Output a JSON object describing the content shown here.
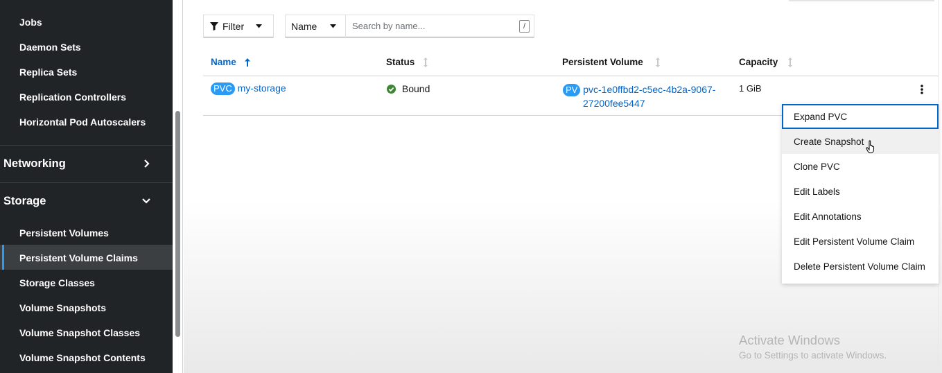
{
  "sidebar": {
    "items_top": [
      {
        "label": "Jobs"
      },
      {
        "label": "Daemon Sets"
      },
      {
        "label": "Replica Sets"
      },
      {
        "label": "Replication Controllers"
      },
      {
        "label": "Horizontal Pod Autoscalers"
      }
    ],
    "networking": {
      "label": "Networking",
      "icon": "chevron-right-icon"
    },
    "storage": {
      "label": "Storage",
      "icon": "chevron-down-icon"
    },
    "storage_items": [
      {
        "label": "Persistent Volumes"
      },
      {
        "label": "Persistent Volume Claims",
        "active": true
      },
      {
        "label": "Storage Classes"
      },
      {
        "label": "Volume Snapshots"
      },
      {
        "label": "Volume Snapshot Classes"
      },
      {
        "label": "Volume Snapshot Contents"
      }
    ]
  },
  "toolbar": {
    "filter_label": "Filter",
    "name_select": "Name",
    "search_placeholder": "Search by name...",
    "search_shortcut": "/"
  },
  "table": {
    "columns": [
      "Name",
      "Status",
      "Persistent Volume",
      "Capacity"
    ],
    "rows": [
      {
        "name_badge": "PVC",
        "name": "my-storage",
        "status": "Bound",
        "pv_badge": "PV",
        "pv_line1": "pvc-1e0ffbd2-c5ec-4b2a-9067-",
        "pv_line2": "27200fee5447",
        "capacity": "1 GiB"
      }
    ]
  },
  "menu": {
    "items": [
      "Expand PVC",
      "Create Snapshot",
      "Clone PVC",
      "Edit Labels",
      "Edit Annotations",
      "Edit Persistent Volume Claim",
      "Delete Persistent Volume Claim"
    ]
  },
  "watermark": {
    "title": "Activate Windows",
    "subtitle": "Go to Settings to activate Windows."
  },
  "colors": {
    "sidebar_bg": "#212427",
    "accent": "#0066cc",
    "badge": "#2b9af3",
    "status_ok": "#3e8635"
  }
}
